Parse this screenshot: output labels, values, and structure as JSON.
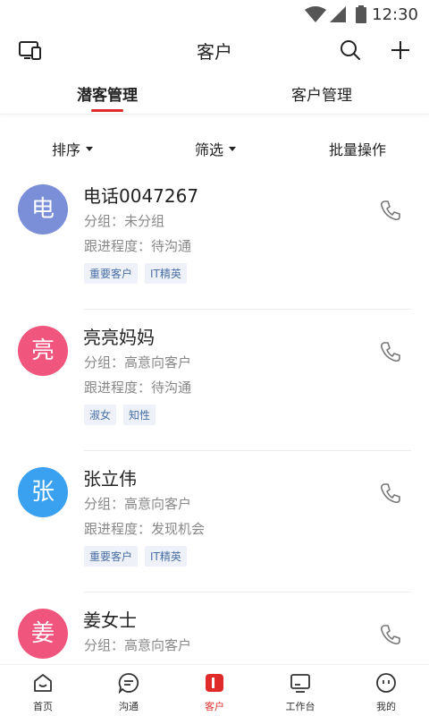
{
  "status_bar": {
    "time": "12:30"
  },
  "header": {
    "title": "客户",
    "left_icon": "devices-icon",
    "right_icons": [
      "search-icon",
      "add-icon"
    ]
  },
  "tabs": [
    {
      "label": "潜客管理",
      "active": true
    },
    {
      "label": "客户管理",
      "active": false
    }
  ],
  "filters": {
    "sort": "排序",
    "filter": "筛选",
    "batch": "批量操作"
  },
  "customers": [
    {
      "avatar": "电",
      "avatar_color": "#7b8fd8",
      "name": "电话0047267",
      "group": "分组：未分组",
      "progress": "跟进程度：待沟通",
      "tags": [
        "重要客户",
        "IT精英"
      ]
    },
    {
      "avatar": "亮",
      "avatar_color": "#f0567d",
      "name": "亮亮妈妈",
      "group": "分组：高意向客户",
      "progress": "跟进程度：待沟通",
      "tags": [
        "淑女",
        "知性"
      ]
    },
    {
      "avatar": "张",
      "avatar_color": "#3aa0f0",
      "name": "张立伟",
      "group": "分组：高意向客户",
      "progress": "跟进程度：发现机会",
      "tags": [
        "重要客户",
        "IT精英"
      ]
    },
    {
      "avatar": "姜",
      "avatar_color": "#f0567d",
      "name": "姜女士",
      "group": "分组：高意向客户",
      "progress": "",
      "tags": []
    }
  ],
  "bottom_nav": [
    {
      "label": "首页",
      "icon": "home-icon",
      "active": false
    },
    {
      "label": "沟通",
      "icon": "chat-icon",
      "active": false
    },
    {
      "label": "客户",
      "icon": "customer-icon",
      "active": true
    },
    {
      "label": "工作台",
      "icon": "workbench-icon",
      "active": false
    },
    {
      "label": "我的",
      "icon": "profile-icon",
      "active": false
    }
  ],
  "colors": {
    "accent": "#e02b2b",
    "tag_text": "#4a6fa5",
    "tag_bg": "#eef2f8"
  }
}
